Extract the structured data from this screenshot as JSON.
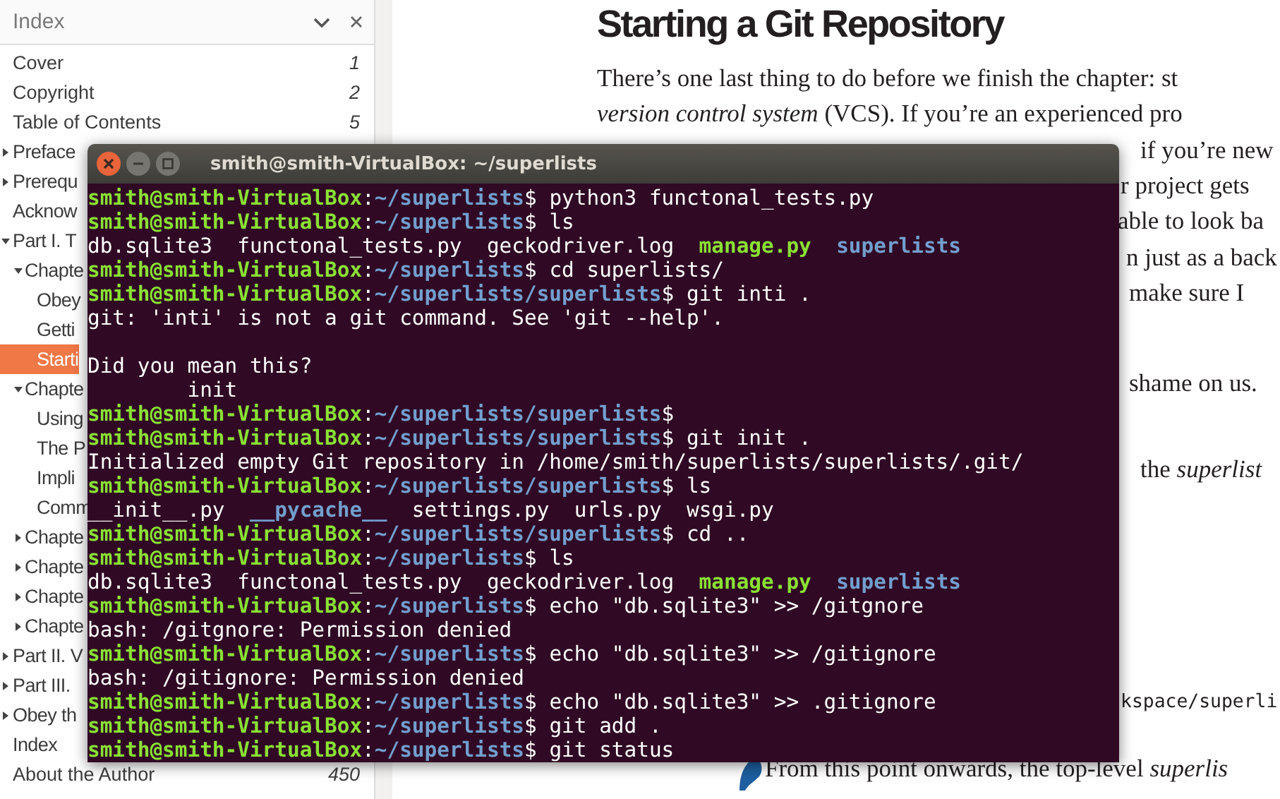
{
  "sidebar": {
    "title": "Index",
    "items": [
      {
        "label": "Cover",
        "page": "1",
        "selected": false
      },
      {
        "label": "Copyright",
        "page": "2",
        "selected": false
      },
      {
        "label": "Table of Contents",
        "page": "5",
        "selected": false
      },
      {
        "label": "Preface",
        "expanded": false,
        "selected": false
      },
      {
        "label": "Prerequ",
        "expanded": false,
        "selected": false
      },
      {
        "label": "Acknow",
        "selected": false
      },
      {
        "label": "Part I. T",
        "expanded": true,
        "selected": false,
        "children": [
          {
            "label": "Chapte",
            "expanded": true,
            "selected": false,
            "children": [
              {
                "label": "Obey",
                "selected": false
              },
              {
                "label": "Getti",
                "selected": false
              },
              {
                "label": "Starti",
                "selected": true
              }
            ]
          },
          {
            "label": "Chapte",
            "expanded": true,
            "selected": false,
            "children": [
              {
                "label": "Using",
                "selected": false
              },
              {
                "label": "The P",
                "selected": false
              },
              {
                "label": "Impli",
                "selected": false
              },
              {
                "label": "Comm",
                "selected": false
              }
            ]
          },
          {
            "label": "Chapte",
            "expanded": false,
            "selected": false
          },
          {
            "label": "Chapte",
            "expanded": false,
            "selected": false
          },
          {
            "label": "Chapte",
            "expanded": false,
            "selected": false
          },
          {
            "label": "Chapte",
            "expanded": false,
            "selected": false
          }
        ]
      },
      {
        "label": "Part II. V",
        "expanded": false,
        "selected": false
      },
      {
        "label": "Part III.",
        "expanded": false,
        "selected": false
      },
      {
        "label": "Obey th",
        "expanded": false,
        "selected": false
      },
      {
        "label": "Index",
        "selected": false
      },
      {
        "label": "About the Author",
        "page": "450",
        "selected": false
      }
    ]
  },
  "page": {
    "heading": "Starting a Git Repository",
    "lines": [
      {
        "kind": "text",
        "text": "There’s one last thing to do before we finish the chapter: st"
      },
      {
        "kind": "text",
        "text": "*version control system* (VCS). If you’re an experienced pro"
      },
      {
        "kind": "text",
        "text": "if you’re new"
      },
      {
        "kind": "text",
        "text": "r project gets"
      },
      {
        "kind": "text",
        "text": "able to look ba"
      },
      {
        "kind": "text",
        "text": "n just as a back"
      },
      {
        "kind": "text",
        "text": "make sure I"
      },
      {
        "kind": "text",
        "text": "shame on us."
      },
      {
        "kind": "text",
        "text": "the *superlist*"
      },
      {
        "kind": "code",
        "text": "kspace/superli"
      },
      {
        "kind": "text",
        "text": "From this point onwards, the top-level *superlis*"
      }
    ]
  },
  "terminal": {
    "title": "smith@smith-VirtualBox: ~/superlists",
    "lines": [
      {
        "kind": "text",
        "segments": [
          {
            "kind": "user",
            "text": "smith@smith-VirtualBox"
          },
          {
            "kind": "plain",
            "text": ":"
          },
          {
            "kind": "path",
            "text": "~/superlists"
          },
          {
            "kind": "plain",
            "text": "$ python3 functonal_tests.py"
          }
        ]
      },
      {
        "kind": "text",
        "segments": [
          {
            "kind": "user",
            "text": "smith@smith-VirtualBox"
          },
          {
            "kind": "plain",
            "text": ":"
          },
          {
            "kind": "path",
            "text": "~/superlists"
          },
          {
            "kind": "plain",
            "text": "$ ls"
          }
        ]
      },
      {
        "kind": "text",
        "segments": [
          {
            "kind": "plain",
            "text": "db.sqlite3  functonal_tests.py  geckodriver.log  "
          },
          {
            "kind": "exec",
            "text": "manage.py"
          },
          {
            "kind": "dir",
            "text": "  superlists"
          }
        ]
      },
      {
        "kind": "text",
        "segments": [
          {
            "kind": "user",
            "text": "smith@smith-VirtualBox"
          },
          {
            "kind": "plain",
            "text": ":"
          },
          {
            "kind": "path",
            "text": "~/superlists"
          },
          {
            "kind": "plain",
            "text": "$ cd superlists/"
          }
        ]
      },
      {
        "kind": "text",
        "segments": [
          {
            "kind": "user",
            "text": "smith@smith-VirtualBox"
          },
          {
            "kind": "plain",
            "text": ":"
          },
          {
            "kind": "path",
            "text": "~/superlists/superlists"
          },
          {
            "kind": "plain",
            "text": "$ git inti ."
          }
        ]
      },
      {
        "kind": "text",
        "segments": [
          {
            "kind": "plain",
            "text": "git: 'inti' is not a git command. See 'git --help'."
          }
        ]
      },
      {
        "kind": "blank"
      },
      {
        "kind": "text",
        "segments": [
          {
            "kind": "plain",
            "text": "Did you mean this?"
          }
        ]
      },
      {
        "kind": "text",
        "segments": [
          {
            "kind": "plain",
            "text": "        init"
          }
        ]
      },
      {
        "kind": "text",
        "segments": [
          {
            "kind": "user",
            "text": "smith@smith-VirtualBox"
          },
          {
            "kind": "plain",
            "text": ":"
          },
          {
            "kind": "path",
            "text": "~/superlists/superlists"
          },
          {
            "kind": "plain",
            "text": "$"
          }
        ]
      },
      {
        "kind": "text",
        "segments": [
          {
            "kind": "user",
            "text": "smith@smith-VirtualBox"
          },
          {
            "kind": "plain",
            "text": ":"
          },
          {
            "kind": "path",
            "text": "~/superlists/superlists"
          },
          {
            "kind": "plain",
            "text": "$ git init ."
          }
        ]
      },
      {
        "kind": "text",
        "segments": [
          {
            "kind": "plain",
            "text": "Initialized empty Git repository in /home/smith/superlists/superlists/.git/"
          }
        ]
      },
      {
        "kind": "text",
        "segments": [
          {
            "kind": "user",
            "text": "smith@smith-VirtualBox"
          },
          {
            "kind": "plain",
            "text": ":"
          },
          {
            "kind": "path",
            "text": "~/superlists/superlists"
          },
          {
            "kind": "plain",
            "text": "$ ls"
          }
        ]
      },
      {
        "kind": "text",
        "segments": [
          {
            "kind": "plain",
            "text": "__init__.py  "
          },
          {
            "kind": "dir",
            "text": "__pycache__"
          },
          {
            "kind": "plain",
            "text": "  settings.py  urls.py  wsgi.py"
          }
        ]
      },
      {
        "kind": "text",
        "segments": [
          {
            "kind": "user",
            "text": "smith@smith-VirtualBox"
          },
          {
            "kind": "plain",
            "text": ":"
          },
          {
            "kind": "path",
            "text": "~/superlists/superlists"
          },
          {
            "kind": "plain",
            "text": "$ cd .."
          }
        ]
      },
      {
        "kind": "text",
        "segments": [
          {
            "kind": "user",
            "text": "smith@smith-VirtualBox"
          },
          {
            "kind": "plain",
            "text": ":"
          },
          {
            "kind": "path",
            "text": "~/superlists"
          },
          {
            "kind": "plain",
            "text": "$ ls"
          }
        ]
      },
      {
        "kind": "text",
        "segments": [
          {
            "kind": "plain",
            "text": "db.sqlite3  functonal_tests.py  geckodriver.log  "
          },
          {
            "kind": "exec",
            "text": "manage.py"
          },
          {
            "kind": "dir",
            "text": "  superlists"
          }
        ]
      },
      {
        "kind": "text",
        "segments": [
          {
            "kind": "user",
            "text": "smith@smith-VirtualBox"
          },
          {
            "kind": "plain",
            "text": ":"
          },
          {
            "kind": "path",
            "text": "~/superlists"
          },
          {
            "kind": "plain",
            "text": "$ echo \"db.sqlite3\" >> /gitgnore"
          }
        ]
      },
      {
        "kind": "text",
        "segments": [
          {
            "kind": "plain",
            "text": "bash: /gitgnore: Permission denied"
          }
        ]
      },
      {
        "kind": "text",
        "segments": [
          {
            "kind": "user",
            "text": "smith@smith-VirtualBox"
          },
          {
            "kind": "plain",
            "text": ":"
          },
          {
            "kind": "path",
            "text": "~/superlists"
          },
          {
            "kind": "plain",
            "text": "$ echo \"db.sqlite3\" >> /gitignore"
          }
        ]
      },
      {
        "kind": "text",
        "segments": [
          {
            "kind": "plain",
            "text": "bash: /gitignore: Permission denied"
          }
        ]
      },
      {
        "kind": "text",
        "segments": [
          {
            "kind": "user",
            "text": "smith@smith-VirtualBox"
          },
          {
            "kind": "plain",
            "text": ":"
          },
          {
            "kind": "path",
            "text": "~/superlists"
          },
          {
            "kind": "plain",
            "text": "$ echo \"db.sqlite3\" >> .gitignore"
          }
        ]
      },
      {
        "kind": "text",
        "segments": [
          {
            "kind": "user",
            "text": "smith@smith-VirtualBox"
          },
          {
            "kind": "plain",
            "text": ":"
          },
          {
            "kind": "path",
            "text": "~/superlists"
          },
          {
            "kind": "plain",
            "text": "$ git add ."
          }
        ]
      },
      {
        "kind": "text",
        "segments": [
          {
            "kind": "user",
            "text": "smith@smith-VirtualBox"
          },
          {
            "kind": "plain",
            "text": ":"
          },
          {
            "kind": "path",
            "text": "~/superlists"
          },
          {
            "kind": "plain",
            "text": "$ git status"
          }
        ]
      }
    ]
  }
}
